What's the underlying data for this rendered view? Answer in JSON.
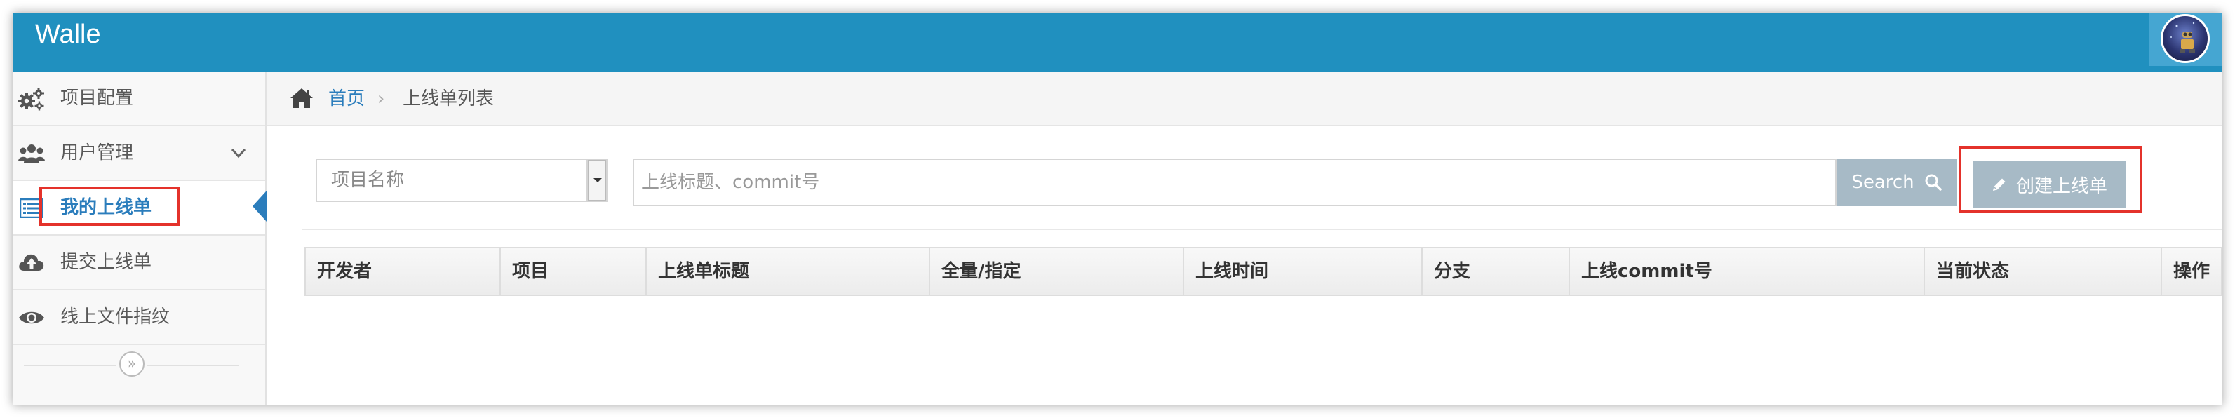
{
  "app": {
    "brand": "Walle",
    "accent_color": "#2090bf",
    "avatar_icon": "robot-avatar-icon"
  },
  "sidebar": {
    "items": [
      {
        "label": "项目配置",
        "icon": "gears-icon"
      },
      {
        "label": "用户管理",
        "icon": "users-icon",
        "has_submenu": true
      },
      {
        "label": "我的上线单",
        "icon": "list-icon",
        "active": true
      },
      {
        "label": "提交上线单",
        "icon": "cloud-upload-icon"
      },
      {
        "label": "线上文件指纹",
        "icon": "eye-icon"
      }
    ],
    "collapse_glyph": "»"
  },
  "breadcrumb": {
    "home": "首页",
    "separator": "›",
    "current": "上线单列表"
  },
  "filters": {
    "project_select": {
      "selected": "项目名称"
    },
    "search": {
      "placeholder": "上线标题、commit号"
    },
    "search_button": "Search",
    "create_button": "创建上线单"
  },
  "table": {
    "columns": [
      "开发者",
      "项目",
      "上线单标题",
      "全量/指定",
      "上线时间",
      "分支",
      "上线commit号",
      "当前状态",
      "操作"
    ]
  },
  "highlight_color": "#e4322b"
}
